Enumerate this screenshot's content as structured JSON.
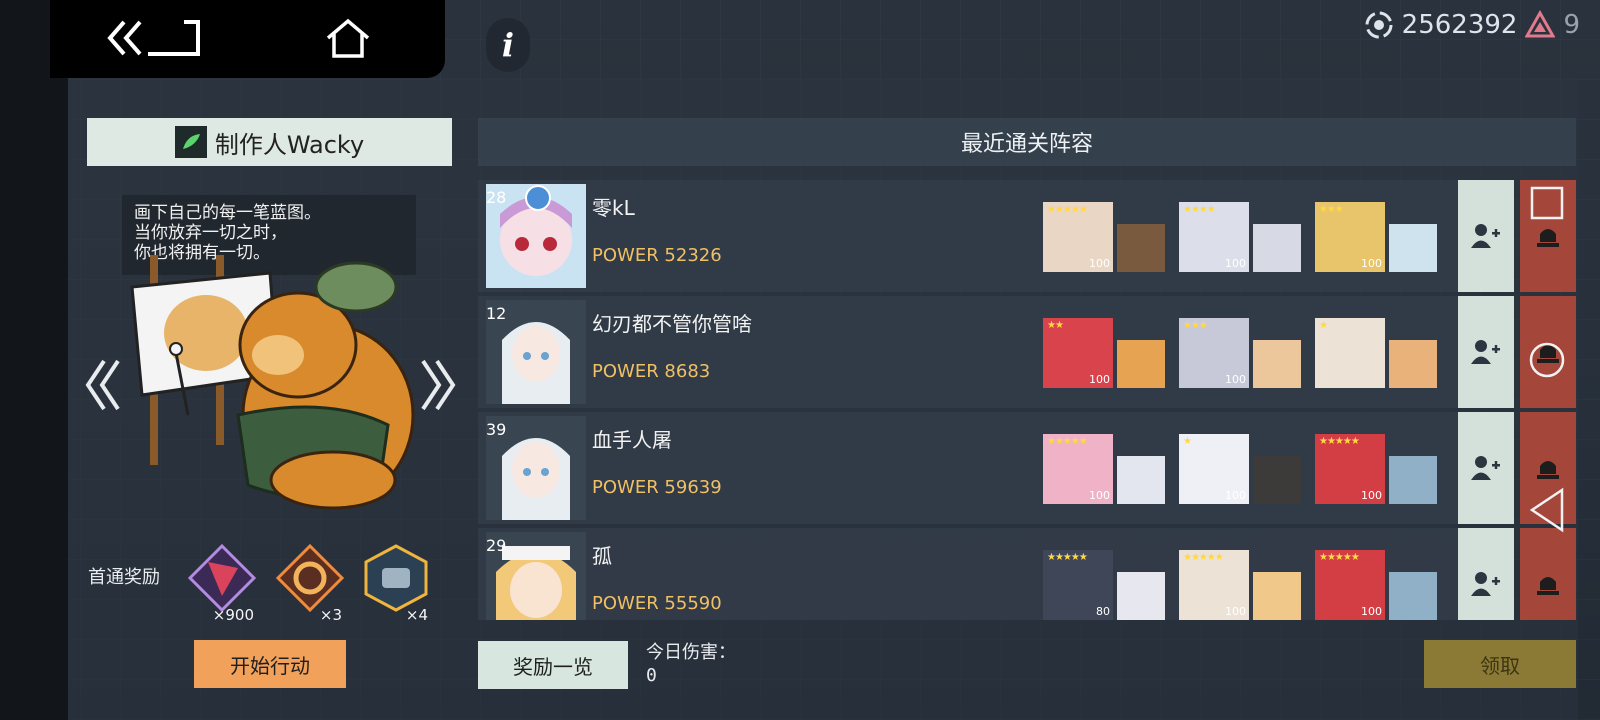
{
  "currency": {
    "coin_value": "2562392",
    "gem_value": "9"
  },
  "maker": {
    "label": "制作人Wacky"
  },
  "quote": {
    "lines": [
      "画下自己的每一笔蓝图。",
      "当你放弃一切之时，",
      "你也将拥有一切。"
    ]
  },
  "rewards": {
    "label": "首通奖励",
    "items": [
      {
        "icon": "red-crystal-icon",
        "count": "×900"
      },
      {
        "icon": "gold-ring-icon",
        "count": "×3"
      },
      {
        "icon": "hex-module-icon",
        "count": "×4"
      }
    ]
  },
  "start_button": "开始行动",
  "list": {
    "title": "最近通关阵容",
    "rows": [
      {
        "level": "28",
        "name": "零kL",
        "power": "POWER 52326",
        "avatar": "pink-chibi-avatar",
        "heroes": [
          {
            "stars": "★★★★★",
            "lv": "100",
            "el": "💧"
          },
          {
            "stars": "★★★★",
            "lv": "100",
            "el": "✦"
          },
          {
            "stars": "★★★",
            "lv": "100",
            "el": "🔥"
          }
        ]
      },
      {
        "level": "12",
        "name": "幻刃都不管你管啥",
        "power": "POWER 8683",
        "avatar": "white-hair-avatar",
        "heroes": [
          {
            "stars": "★★",
            "lv": "100",
            "el": "🔥"
          },
          {
            "stars": "★★★",
            "lv": "100",
            "el": "✦"
          },
          {
            "stars": "★",
            "lv": "",
            "el": "💧"
          }
        ]
      },
      {
        "level": "39",
        "name": "血手人屠",
        "power": "POWER 59639",
        "avatar": "white-hair-avatar",
        "heroes": [
          {
            "stars": "★★★★★",
            "lv": "100",
            "el": "⚡"
          },
          {
            "stars": "★",
            "lv": "100",
            "el": "🍃"
          },
          {
            "stars": "★★★★★",
            "lv": "100",
            "el": "🔥"
          }
        ]
      },
      {
        "level": "29",
        "name": "孤",
        "power": "POWER 55590",
        "avatar": "blonde-avatar",
        "heroes": [
          {
            "stars": "★★★★★",
            "lv": "80",
            "el": "✦"
          },
          {
            "stars": "★★★★★",
            "lv": "100",
            "el": "💧"
          },
          {
            "stars": "★★★★★",
            "lv": "100",
            "el": "🔥"
          }
        ]
      }
    ]
  },
  "footer": {
    "reward_list_button": "奖励一览",
    "damage_label": "今日伤害：",
    "damage_value": "0",
    "claim_button": "领取"
  },
  "colors": {
    "accent_orange": "#f1a15a",
    "mint": "#d4e1db",
    "danger_red": "#a4463a",
    "power_gold": "#f0c064"
  }
}
